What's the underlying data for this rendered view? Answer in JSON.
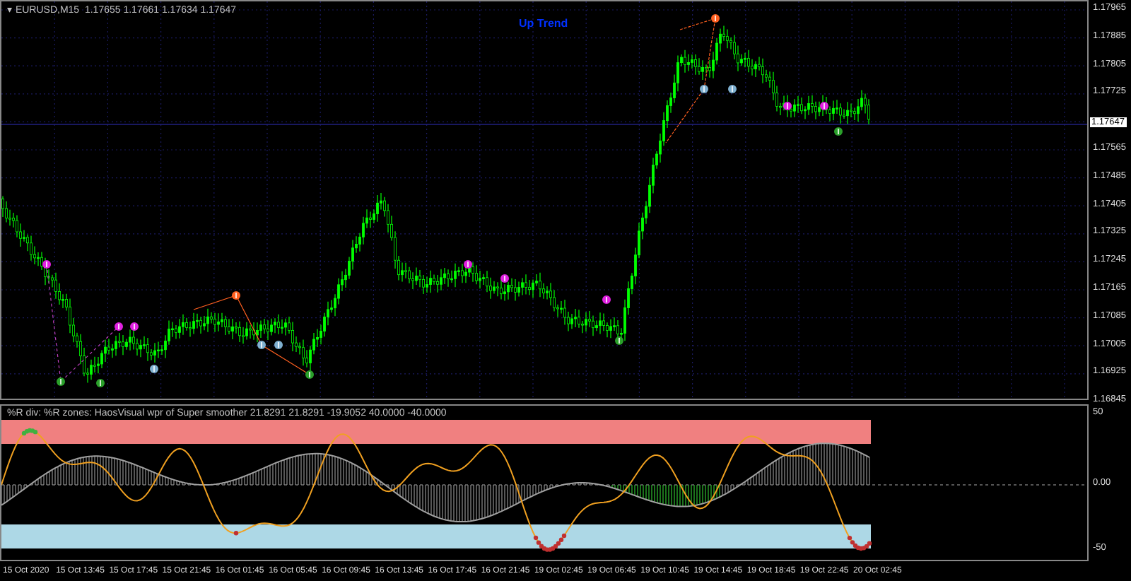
{
  "chart_header": {
    "menu_glyph": "▾",
    "symbol": "EURUSD,M15",
    "quote": "1.17655 1.17661 1.17634 1.17647"
  },
  "trend_label": "Up Trend",
  "price_axis": {
    "labels": [
      "1.17965",
      "1.17885",
      "1.17805",
      "1.17725",
      "1.17565",
      "1.17485",
      "1.17405",
      "1.17325",
      "1.17245",
      "1.17165",
      "1.17085",
      "1.17005",
      "1.16925",
      "1.16845"
    ],
    "current_price": "1.17647"
  },
  "indicator": {
    "header": "%R div: %R zones:  HaosVisual wpr of Super smoother 21.8291 21.8291 -19.9052 40.0000 -40.0000",
    "axis_labels": [
      "50",
      "0.00",
      "-50"
    ]
  },
  "time_axis": [
    "15 Oct 2020",
    "15 Oct 13:45",
    "15 Oct 17:45",
    "15 Oct 21:45",
    "16 Oct 01:45",
    "16 Oct 05:45",
    "16 Oct 09:45",
    "16 Oct 13:45",
    "16 Oct 17:45",
    "16 Oct 21:45",
    "19 Oct 02:45",
    "19 Oct 06:45",
    "19 Oct 10:45",
    "19 Oct 14:45",
    "19 Oct 18:45",
    "19 Oct 22:45",
    "20 Oct 02:45"
  ]
}
